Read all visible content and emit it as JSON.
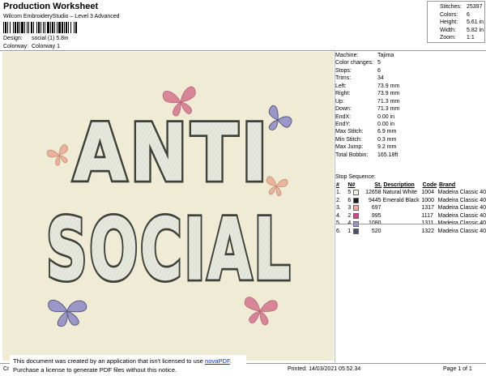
{
  "header": {
    "title": "Production Worksheet",
    "subtitle": "Wilcom EmbroideryStudio – Level 3 Advanced",
    "design_label": "Design:",
    "design_value": "social (1) 5.8in",
    "colorway_label": "Colorway:",
    "colorway_value": "Colorway 1"
  },
  "stats": [
    {
      "label": "Stitches:",
      "value": "25397"
    },
    {
      "label": "Colors:",
      "value": "6"
    },
    {
      "label": "Height:",
      "value": "5.61 in"
    },
    {
      "label": "Width:",
      "value": "5.82 in"
    },
    {
      "label": "Zoom:",
      "value": "1:1"
    }
  ],
  "artwork": {
    "line1": "ANTI",
    "line2": "SOCIAL",
    "background": "#efebd5",
    "fill_color": "#e6e8de",
    "outline_color": "#3d4139",
    "butterfly_colors": [
      "#d98598",
      "#e9b49b",
      "#9b97c9"
    ]
  },
  "machine_info": [
    {
      "label": "Machine:",
      "value": "Tajima"
    },
    {
      "label": "Color changes:",
      "value": "5"
    },
    {
      "label": "Stops:",
      "value": "6"
    },
    {
      "label": "Trims:",
      "value": "34"
    },
    {
      "label": "Left:",
      "value": "73.9 mm"
    },
    {
      "label": "Right:",
      "value": "73.9 mm"
    },
    {
      "label": "Up:",
      "value": "71.3 mm"
    },
    {
      "label": "Down:",
      "value": "71.3 mm"
    },
    {
      "label": "EndX:",
      "value": "0.00 in"
    },
    {
      "label": "EndY:",
      "value": "0.00 in"
    },
    {
      "label": "Max Stitch:",
      "value": "6.9 mm"
    },
    {
      "label": "Min Stitch:",
      "value": "0.3 mm"
    },
    {
      "label": "Max Jump:",
      "value": "9.2 mm"
    },
    {
      "label": "Total Bobbin:",
      "value": "165.18ft"
    }
  ],
  "stop_sequence": {
    "title": "Stop Sequence:",
    "headers": {
      "num": "#",
      "n": "N#",
      "st": "St.",
      "desc": "Description",
      "code": "Code",
      "brand": "Brand"
    },
    "rows": [
      {
        "num": "1.",
        "n": "5",
        "color": "#f4f4ee",
        "st": "12658",
        "desc": "Natural White",
        "code": "1004",
        "brand": "Madeira Classic 40"
      },
      {
        "num": "2.",
        "n": "6",
        "color": "#1c1c1c",
        "st": "9445",
        "desc": "Emerald Black",
        "code": "1000",
        "brand": "Madeira Classic 40"
      },
      {
        "num": "3.",
        "n": "3",
        "color": "#f1a8a3",
        "st": "697",
        "desc": "",
        "code": "1317",
        "brand": "Madeira Classic 40"
      },
      {
        "num": "4.",
        "n": "2",
        "color": "#d9438c",
        "st": "995",
        "desc": "",
        "code": "1117",
        "brand": "Madeira Classic 40"
      },
      {
        "num": "5.",
        "n": "4",
        "color": "#9a93cf",
        "st": "1080",
        "desc": "",
        "code": "1311",
        "brand": "Madeira Classic 40"
      },
      {
        "num": "6.",
        "n": "1",
        "color": "#4a4f73",
        "st": "520",
        "desc": "",
        "code": "1322",
        "brand": "Madeira Classic 40"
      }
    ]
  },
  "footer": {
    "left_text": "Cr",
    "printed": "Printed: 14/03/2021 05.52.34",
    "page": "Page 1 of 1"
  },
  "notice": {
    "line1_before": "This document was created by an application that isn't licensed to use ",
    "line1_link": "novaPDF",
    "line1_after": ".",
    "line2": "Purchase a license to generate PDF files without this notice."
  }
}
